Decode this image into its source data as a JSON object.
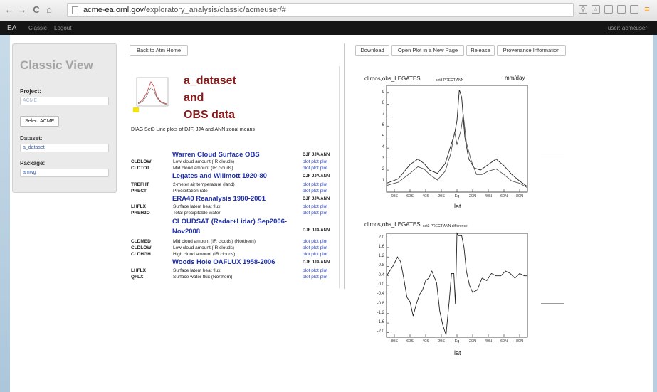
{
  "browser": {
    "back_icon": "←",
    "forward_icon": "→",
    "reload_icon": "C",
    "home_icon": "⌂",
    "url_host": "acme-ea.ornl.gov",
    "url_path": "/exploratory_analysis/classic/acmeuser/#",
    "menu_icon": "≡"
  },
  "topnav": {
    "brand": "EA",
    "link_classic": "Classic",
    "link_logout": "Logout",
    "user": "user: acmeuser"
  },
  "sidebar": {
    "title": "Classic View",
    "project_label": "Project:",
    "project_value": "ACME",
    "select_button": "Select ACME",
    "dataset_label": "Dataset:",
    "dataset_value": "a_dataset",
    "package_label": "Package:",
    "package_value": "amwg"
  },
  "toolbar": {
    "back": "Back to Atm Home",
    "download": "Download",
    "open_plot": "Open Plot in a New Page",
    "release": "Release",
    "provenance": "Provenance Information"
  },
  "main": {
    "heading_line1": "a_dataset",
    "heading_line2": "and",
    "heading_line3": "OBS data",
    "diag_caption": "DIAG Set3 Line plots of DJF, JJA and ANN zonal means",
    "sections": [
      {
        "title": "Warren Cloud Surface OBS",
        "header": "DJF JJA ANN",
        "rows": [
          {
            "var": "CLDLOW",
            "desc": "Low cloud amount (IR clouds)",
            "plots": "plot plot plot"
          },
          {
            "var": "CLDTOT",
            "desc": "Mid cloud amount (IR clouds)",
            "plots": "plot plot plot"
          }
        ]
      },
      {
        "title": "Legates and Willmott 1920-80",
        "header": "DJF JJA ANN",
        "rows": [
          {
            "var": "TREFHT",
            "desc": "2-meter air temperature (land)",
            "plots": "plot plot plot"
          },
          {
            "var": "PRECT",
            "desc": "Precipitation rate",
            "plots": "plot plot plot"
          }
        ]
      },
      {
        "title": "ERA40 Reanalysis 1980-2001",
        "header": "DJF JJA ANN",
        "rows": [
          {
            "var": "LHFLX",
            "desc": "Surface latent heat flux",
            "plots": "plot plot plot"
          },
          {
            "var": "PREH2O",
            "desc": "Total precipitable water",
            "plots": "plot plot plot"
          }
        ]
      },
      {
        "title_line1": "CLOUDSAT (Radar+Lidar) Sep2006-",
        "title_line2": "Nov2008",
        "header": "DJF JJA ANN",
        "rows": [
          {
            "var": "CLDMED",
            "desc": "Mid cloud amount (IR clouds) (Northern)",
            "plots": "plot plot plot"
          },
          {
            "var": "CLDLOW",
            "desc": "Low cloud amount (IR clouds)",
            "plots": "plot plot plot"
          },
          {
            "var": "CLDHGH",
            "desc": "High cloud amount (IR clouds)",
            "plots": "plot plot plot"
          }
        ]
      },
      {
        "title": "Woods Hole OAFLUX 1958-2006",
        "header": "DJF JJA ANN",
        "rows": [
          {
            "var": "LHFLX",
            "desc": "Surface latent heat flux",
            "plots": "plot plot plot"
          },
          {
            "var": "QFLX",
            "desc": "Surface water flux (Northern)",
            "plots": "plot plot plot"
          }
        ]
      }
    ]
  },
  "chart_data": [
    {
      "type": "line",
      "title": "climos,obs_LEGATES",
      "subtitle": "set3 PRECT ANN",
      "units": "mm/day",
      "xlabel": "lat",
      "ylabel": "",
      "x_ticks": [
        "60S",
        "60S",
        "40S",
        "20S",
        "Eq",
        "20N",
        "40N",
        "60N",
        "80N"
      ],
      "y_ticks": [
        "9",
        "8",
        "7",
        "6",
        "5",
        "4",
        "3",
        "2",
        "1"
      ],
      "xlim": [
        -90,
        90
      ],
      "ylim": [
        0,
        9.7
      ],
      "series": [
        {
          "values": [
            [
              -90,
              0.8
            ],
            [
              -75,
              1.2
            ],
            [
              -60,
              2.5
            ],
            [
              -50,
              3.0
            ],
            [
              -42,
              2.6
            ],
            [
              -35,
              2.0
            ],
            [
              -25,
              1.7
            ],
            [
              -15,
              2.6
            ],
            [
              -8,
              4.2
            ],
            [
              -3,
              5.3
            ],
            [
              0,
              6.5
            ],
            [
              3,
              9.3
            ],
            [
              6,
              8.6
            ],
            [
              10,
              5.0
            ],
            [
              15,
              3.0
            ],
            [
              22,
              2.2
            ],
            [
              30,
              2.0
            ],
            [
              40,
              2.5
            ],
            [
              50,
              3.0
            ],
            [
              60,
              2.4
            ],
            [
              70,
              1.6
            ],
            [
              80,
              1.0
            ],
            [
              90,
              0.5
            ]
          ]
        },
        {
          "values": [
            [
              -90,
              0.6
            ],
            [
              -75,
              0.9
            ],
            [
              -60,
              1.7
            ],
            [
              -50,
              2.3
            ],
            [
              -42,
              2.1
            ],
            [
              -35,
              1.6
            ],
            [
              -25,
              1.1
            ],
            [
              -15,
              1.9
            ],
            [
              -8,
              3.5
            ],
            [
              -3,
              5.5
            ],
            [
              0,
              4.3
            ],
            [
              5,
              5.6
            ],
            [
              8,
              7.1
            ],
            [
              12,
              4.5
            ],
            [
              18,
              2.9
            ],
            [
              25,
              1.6
            ],
            [
              32,
              1.6
            ],
            [
              40,
              1.9
            ],
            [
              50,
              2.1
            ],
            [
              60,
              1.6
            ],
            [
              70,
              1.0
            ],
            [
              80,
              0.8
            ],
            [
              90,
              0.4
            ]
          ]
        }
      ]
    },
    {
      "type": "line",
      "title": "climos,obs_LEGATES",
      "subtitle": "set3 PRECT ANN difference",
      "xlabel": "lat",
      "ylabel": "",
      "x_ticks": [
        "80S",
        "60S",
        "40S",
        "20S",
        "Eq",
        "20N",
        "40N",
        "60N",
        "80N"
      ],
      "y_ticks": [
        "2.0",
        "1.6",
        "1.2",
        "0.8",
        "0.4",
        "0.0",
        "-0.4",
        "-0.8",
        "-1.2",
        "-1.6",
        "-2.0"
      ],
      "xlim": [
        -90,
        90
      ],
      "ylim": [
        -2.2,
        2.2
      ],
      "series": [
        {
          "values": [
            [
              -90,
              0.4
            ],
            [
              -82,
              0.8
            ],
            [
              -76,
              1.2
            ],
            [
              -72,
              1.0
            ],
            [
              -68,
              0.3
            ],
            [
              -64,
              -0.5
            ],
            [
              -60,
              -0.7
            ],
            [
              -56,
              -1.3
            ],
            [
              -52,
              -0.8
            ],
            [
              -48,
              -0.4
            ],
            [
              -44,
              -0.2
            ],
            [
              -40,
              0.2
            ],
            [
              -36,
              0.3
            ],
            [
              -32,
              0.6
            ],
            [
              -26,
              0.1
            ],
            [
              -22,
              -1.1
            ],
            [
              -18,
              -1.7
            ],
            [
              -14,
              -2.1
            ],
            [
              -10,
              -0.7
            ],
            [
              -7,
              0.5
            ],
            [
              -4,
              0.5
            ],
            [
              -2,
              -0.8
            ],
            [
              0,
              2.2
            ],
            [
              2,
              2.1
            ],
            [
              6,
              2.1
            ],
            [
              9,
              1.6
            ],
            [
              12,
              0.6
            ],
            [
              16,
              0.0
            ],
            [
              20,
              -0.3
            ],
            [
              26,
              -0.2
            ],
            [
              32,
              0.3
            ],
            [
              38,
              0.2
            ],
            [
              44,
              0.5
            ],
            [
              50,
              0.4
            ],
            [
              56,
              0.4
            ],
            [
              62,
              0.6
            ],
            [
              68,
              0.5
            ],
            [
              74,
              0.3
            ],
            [
              80,
              0.5
            ],
            [
              86,
              0.4
            ],
            [
              90,
              0.4
            ]
          ]
        }
      ]
    }
  ]
}
